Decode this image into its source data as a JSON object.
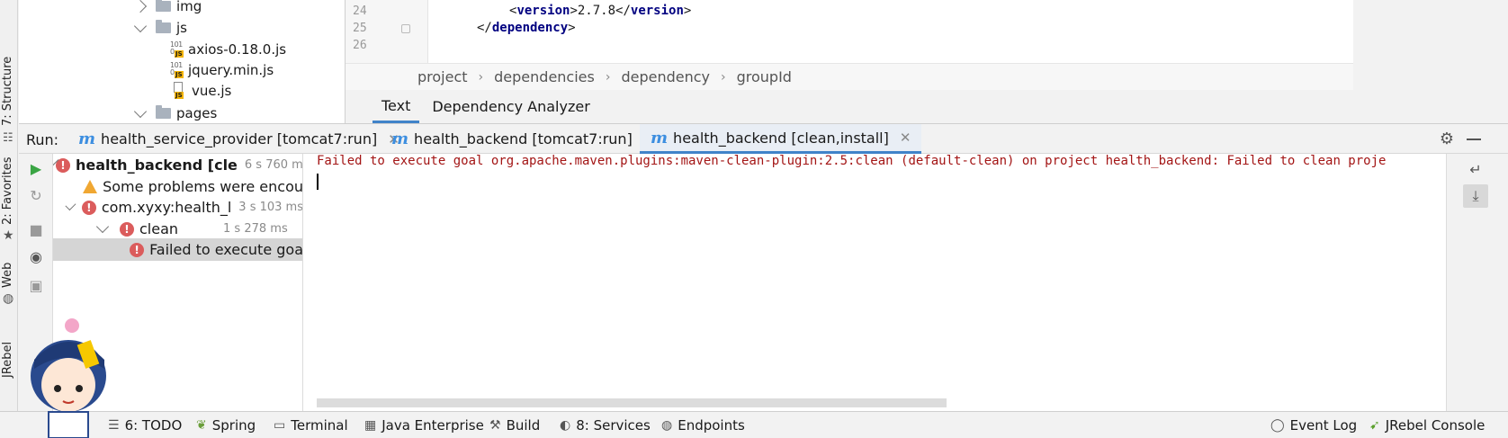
{
  "left_strip": {
    "structure": "7: Structure",
    "favorites": "2: Favorites",
    "web": "Web",
    "jrebel": "JRebel"
  },
  "project_tree": {
    "items": [
      {
        "label": "img",
        "type": "folder",
        "expanded": false
      },
      {
        "label": "js",
        "type": "folder",
        "expanded": true
      },
      {
        "label": "axios-0.18.0.js",
        "type": "js-file"
      },
      {
        "label": "jquery.min.js",
        "type": "js-file"
      },
      {
        "label": "vue.js",
        "type": "js-doc"
      },
      {
        "label": "pages",
        "type": "folder",
        "expanded": true
      }
    ]
  },
  "editor": {
    "lines": [
      {
        "num": "24",
        "code": "<version>2.7.8</version>"
      },
      {
        "num": "25",
        "code": "</dependency>"
      },
      {
        "num": "26",
        "code": ""
      }
    ],
    "breadcrumbs": [
      "project",
      "dependencies",
      "dependency",
      "groupId"
    ],
    "tabs": [
      "Text",
      "Dependency Analyzer"
    ],
    "active_tab": "Text"
  },
  "run": {
    "label": "Run:",
    "tabs": [
      {
        "label": "health_service_provider [tomcat7:run]"
      },
      {
        "label": "health_backend [tomcat7:run]"
      },
      {
        "label": "health_backend [clean,install]"
      }
    ],
    "active_tab_index": 2,
    "tree": [
      {
        "label": "health_backend [cle",
        "time": "6 s 760 ms",
        "status": "error",
        "bold": true
      },
      {
        "label": "Some problems were encou",
        "time": "",
        "status": "warning"
      },
      {
        "label": "com.xyxy:health_l",
        "time": "3 s 103 ms",
        "status": "error"
      },
      {
        "label": "clean",
        "time": "1 s 278 ms",
        "status": "error"
      },
      {
        "label": "Failed to execute goa",
        "time": "",
        "status": "error",
        "selected": true
      }
    ],
    "console_text": "Failed to execute goal org.apache.maven.plugins:maven-clean-plugin:2.5:clean (default-clean) on project health_backend: Failed to clean proje"
  },
  "statusbar": {
    "left": [
      {
        "label": "6: TODO",
        "icon": "list-icon"
      },
      {
        "label": "Spring",
        "icon": "spring-leaf-icon"
      },
      {
        "label": "Terminal",
        "icon": "terminal-icon"
      },
      {
        "label": "Java Enterprise",
        "icon": "java-enterprise-icon"
      },
      {
        "label": "Build",
        "icon": "hammer-icon"
      },
      {
        "label": "8: Services",
        "icon": "services-icon"
      },
      {
        "label": "Endpoints",
        "icon": "globe-icon"
      }
    ],
    "right": [
      {
        "label": "Event Log",
        "icon": "speech-bubble-icon"
      },
      {
        "label": "JRebel Console",
        "icon": "jrebel-icon"
      }
    ]
  },
  "colors": {
    "accent": "#4083c9",
    "error": "#db5c5c",
    "console_error_text": "#a31515",
    "warning": "#f0a732"
  }
}
